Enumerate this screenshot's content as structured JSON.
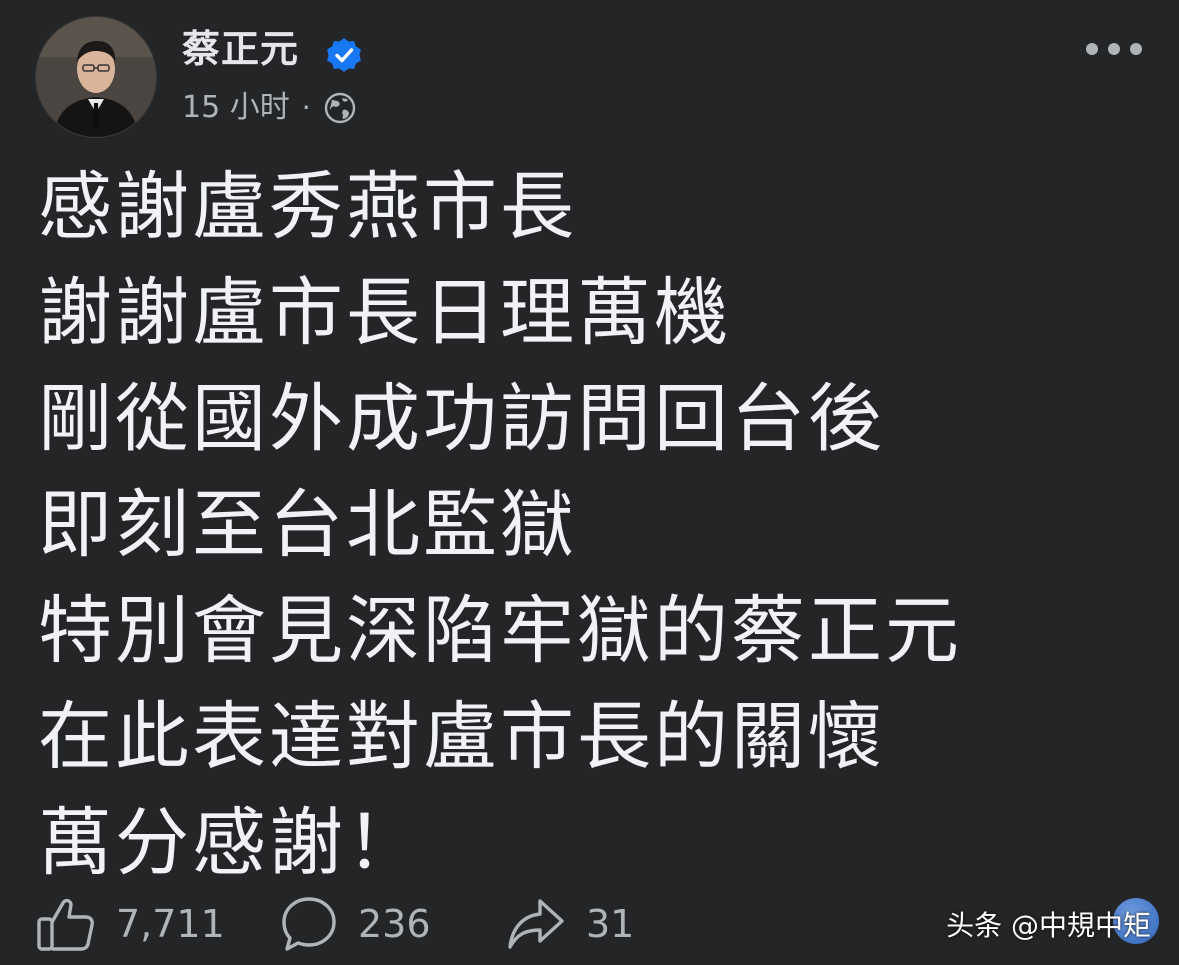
{
  "post": {
    "author": {
      "name": "蔡正元",
      "verified": true,
      "avatar": "author-avatar"
    },
    "meta": {
      "time": "15 小时",
      "separator": "·",
      "audience_icon": "globe-icon"
    },
    "more_icon": "more-options-icon",
    "body_lines": [
      "感謝盧秀燕市長",
      "謝謝盧市長日理萬機",
      "剛從國外成功訪問回台後",
      "即刻至台北監獄",
      "特別會見深陷牢獄的蔡正元",
      "在此表達對盧市長的關懷",
      "萬分感謝！"
    ]
  },
  "actions": {
    "like": {
      "icon": "thumbs-up-icon",
      "count": "7,711"
    },
    "comment": {
      "icon": "comment-icon",
      "count": "236"
    },
    "share": {
      "icon": "share-icon",
      "count": "31"
    }
  },
  "watermark": {
    "text": "头条 @中規中矩"
  },
  "colors": {
    "background": "#242526",
    "text_primary": "#e4e6eb",
    "text_secondary": "#b0b3b8",
    "verified_badge": "#1877f2"
  }
}
